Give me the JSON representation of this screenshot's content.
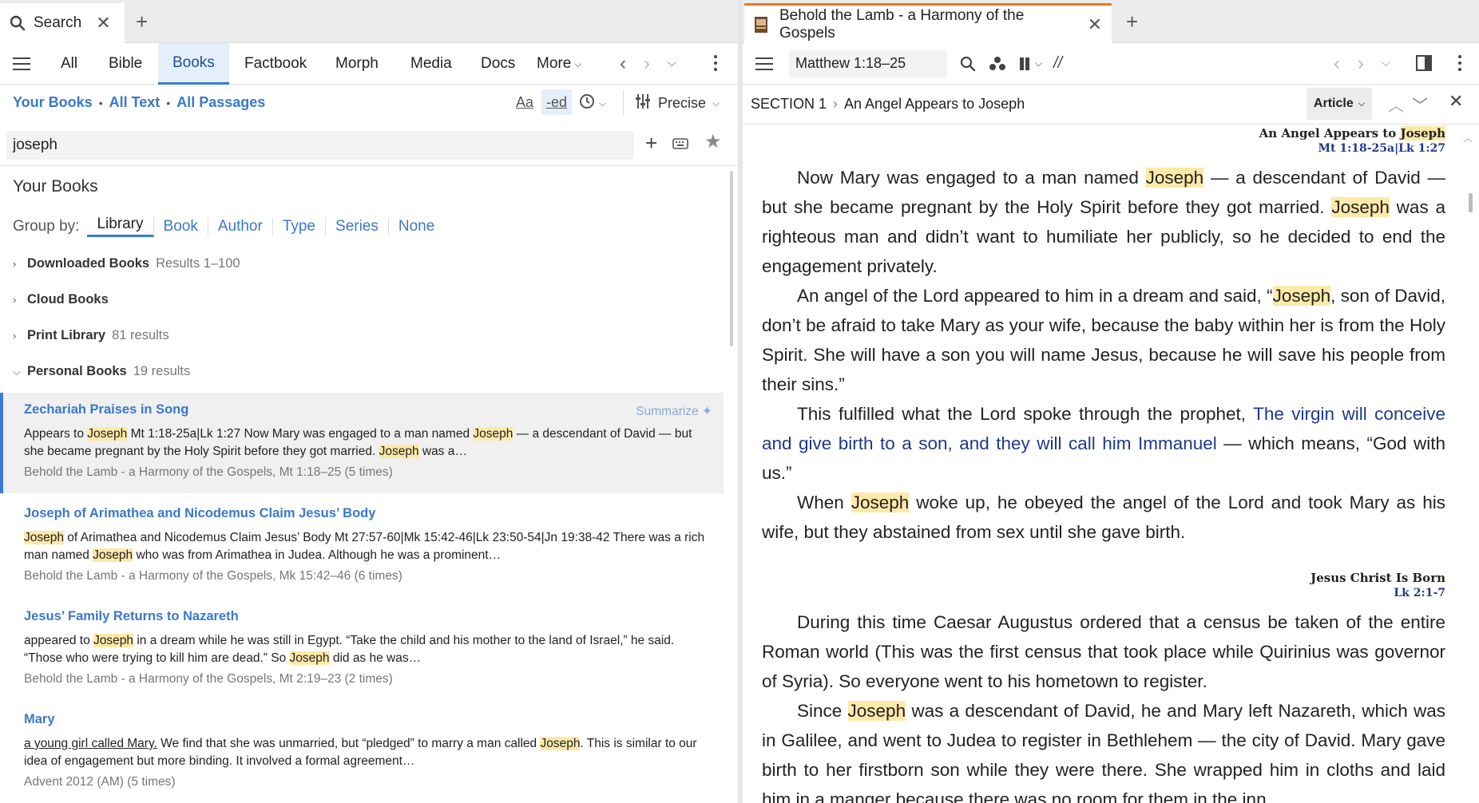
{
  "left": {
    "tab": {
      "label": "Search",
      "icon": "search-icon"
    },
    "nav_tabs": [
      "All",
      "Bible",
      "Books",
      "Factbook",
      "Morph",
      "Media",
      "Docs",
      "More"
    ],
    "active_tab": "Books",
    "scope": {
      "books": "Your Books",
      "text": "All Text",
      "passages": "All Passages"
    },
    "search": {
      "value": "joseph"
    },
    "precision": "Precise",
    "section_title": "Your Books",
    "group_by": {
      "label": "Group by:",
      "options": [
        "Library",
        "Book",
        "Author",
        "Type",
        "Series",
        "None"
      ],
      "active": "Library"
    },
    "groups": [
      {
        "name": "Downloaded Books",
        "count": "Results 1–100",
        "expanded": false
      },
      {
        "name": "Cloud Books",
        "count": "",
        "expanded": false
      },
      {
        "name": "Print Library",
        "count": "81 results",
        "expanded": false
      },
      {
        "name": "Personal Books",
        "count": "19 results",
        "expanded": true
      }
    ],
    "summarize_label": "Summarize",
    "results": [
      {
        "title": "Zechariah Praises in Song",
        "snippet": [
          {
            "t": "Appears to "
          },
          {
            "t": "Joseph",
            "hl": true
          },
          {
            "t": " Mt 1:18-25a|Lk 1:27 Now Mary was engaged to a man named "
          },
          {
            "t": "Joseph",
            "hl": true
          },
          {
            "t": " — a descendant of David — but she became pregnant by the Holy Spirit before they got married. "
          },
          {
            "t": "Joseph",
            "hl": true
          },
          {
            "t": " was a…"
          }
        ],
        "source": "Behold the Lamb - a Harmony of the Gospels, Mt 1:18–25 (5 times)"
      },
      {
        "title": "Joseph of Arimathea and Nicodemus Claim Jesus’ Body",
        "snippet": [
          {
            "t": "Joseph",
            "hl": true
          },
          {
            "t": " of Arimathea and Nicodemus Claim Jesus’ Body Mt 27:57-60|Mk 15:42-46|Lk 23:50-54|Jn 19:38-42 There was a rich man named "
          },
          {
            "t": "Joseph",
            "hl": true
          },
          {
            "t": " who was from Arimathea in Judea. Although he was a prominent…"
          }
        ],
        "source": "Behold the Lamb - a Harmony of the Gospels, Mk 15:42–46 (6 times)"
      },
      {
        "title": "Jesus’ Family Returns to Nazareth",
        "snippet": [
          {
            "t": "appeared to "
          },
          {
            "t": "Joseph",
            "hl": true
          },
          {
            "t": " in a dream while he was still in Egypt. “Take the child and his mother to the land of Israel,” he said. “Those who were trying to kill him are dead.” So "
          },
          {
            "t": "Joseph",
            "hl": true
          },
          {
            "t": " did as he was…"
          }
        ],
        "source": "Behold the Lamb - a Harmony of the Gospels, Mt 2:19–23 (2 times)"
      },
      {
        "title": "Mary",
        "snippet": [
          {
            "t": "a young girl called Mary.",
            "u": true
          },
          {
            "t": " We find that she was unmarried, but “pledged” to marry a man called "
          },
          {
            "t": "Joseph",
            "hl": true
          },
          {
            "t": ". This is similar to our idea of engagement but more binding. It involved a formal agreement…"
          }
        ],
        "source": "Advent 2012 (AM) (5 times)"
      }
    ]
  },
  "right": {
    "tab": {
      "label": "Behold the Lamb - a Harmony of the Gospels"
    },
    "reference": "Matthew 1:18–25",
    "breadcrumb": {
      "section": "SECTION 1",
      "title": "An Angel Appears to Joseph"
    },
    "view_mode": "Article",
    "headings": [
      {
        "title_pre": "An Angel Appears to ",
        "title_hl": "Joseph",
        "ref": "Mt 1:18-25a|Lk 1:27"
      },
      {
        "title_pre": "Jesus Christ Is Born",
        "title_hl": "",
        "ref": "Lk 2:1-7"
      }
    ],
    "paragraphs_1": [
      [
        {
          "t": "Now Mary was engaged to a man named "
        },
        {
          "t": "Joseph",
          "hl": true
        },
        {
          "t": " — a descendant of David — but she became pregnant by the Holy Spirit before they got married. "
        },
        {
          "t": "Joseph",
          "hl": true
        },
        {
          "t": " was a righteous man and didn’t want to humiliate her publicly, so he decided to end the engagement privately."
        }
      ],
      [
        {
          "t": "An angel of the Lord appeared to him in a dream and said, “"
        },
        {
          "t": "Joseph",
          "hl": true
        },
        {
          "t": ", son of David, don’t be afraid to take Mary as your wife, because the baby within her is from the Holy Spirit. She will have a son you will name Jesus, because he will save his people from their sins.”"
        }
      ],
      [
        {
          "t": "This fulfilled what the Lord spoke through the prophet, "
        },
        {
          "t": "The virgin will conceive and give birth to a son, and they will call him Immanuel",
          "link": true
        },
        {
          "t": " — which means, “God with us.”"
        }
      ],
      [
        {
          "t": "When "
        },
        {
          "t": "Joseph",
          "hl": true
        },
        {
          "t": " woke up, he obeyed the angel of the Lord and took Mary as his wife, but they abstained from sex until she gave birth."
        }
      ]
    ],
    "paragraphs_2": [
      [
        {
          "t": "During this time Caesar Augustus ordered that a census be taken of the entire Roman world (This was the first census that took place while Quirinius was governor of Syria). So everyone went to his hometown to register."
        }
      ],
      [
        {
          "t": "Since "
        },
        {
          "t": "Joseph",
          "hl": true
        },
        {
          "t": " was a descendant of David, he and Mary left Nazareth, which was in Galilee, and went to Judea to register in Bethlehem — the city of David. Mary gave birth to her firstborn son while they were there. She wrapped him in cloths and laid him in a manger because there was no room for them in the inn."
        }
      ]
    ]
  },
  "colors": {
    "accent": "#3a7bd5",
    "link": "#3b78c9",
    "highlight": "#fde9a8",
    "tab_orange": "#e87722",
    "scripture_blue": "#1d3a8a"
  }
}
